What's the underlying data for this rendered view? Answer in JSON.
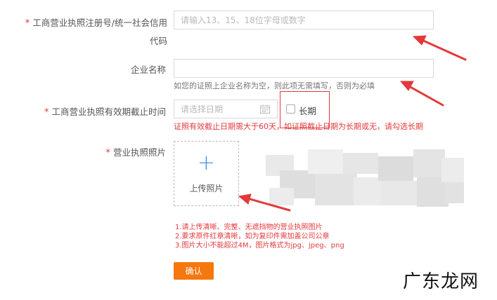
{
  "form": {
    "reg_no": {
      "required_mark": "*",
      "label_line1": "工商营业执照注册号/统一社会信用",
      "label_line2": "代码",
      "placeholder": "请输入13、15、18位字母或数字"
    },
    "company_name": {
      "label": "企业名称",
      "placeholder": "",
      "hint": "如您的证照上企业名称为空，则此项无需填写，否则为必填"
    },
    "expiry": {
      "required_mark": "*",
      "label": "工商营业执照有效期截止时间",
      "placeholder": "请选择日期",
      "long_term_label": "长期",
      "hint": "证照有效截止日期需大于60天，如证照截止日期为长期或无，请勾选长期"
    },
    "photo": {
      "required_mark": "*",
      "label": "营业执照照片",
      "upload_plus": "+",
      "upload_label": "上传照片",
      "notes": [
        "1.请上传清晰、完整、无遮挡物的营业执照图片",
        "2.要求原件红章清晰，如为复印件需加盖公司公章",
        "3.图片大小不能超过4M，图片格式为jpg、jpeg、png"
      ]
    },
    "confirm_label": "确认"
  },
  "watermark": "广东龙网",
  "colors": {
    "required": "#e4393c",
    "error_text": "#e4393c",
    "confirm_button": "#f5780f",
    "annotation_arrow": "#e23a3a",
    "upload_plus": "#4a90e2"
  },
  "icons": [
    "calendar-icon",
    "plus-icon",
    "arrow-annotation"
  ]
}
